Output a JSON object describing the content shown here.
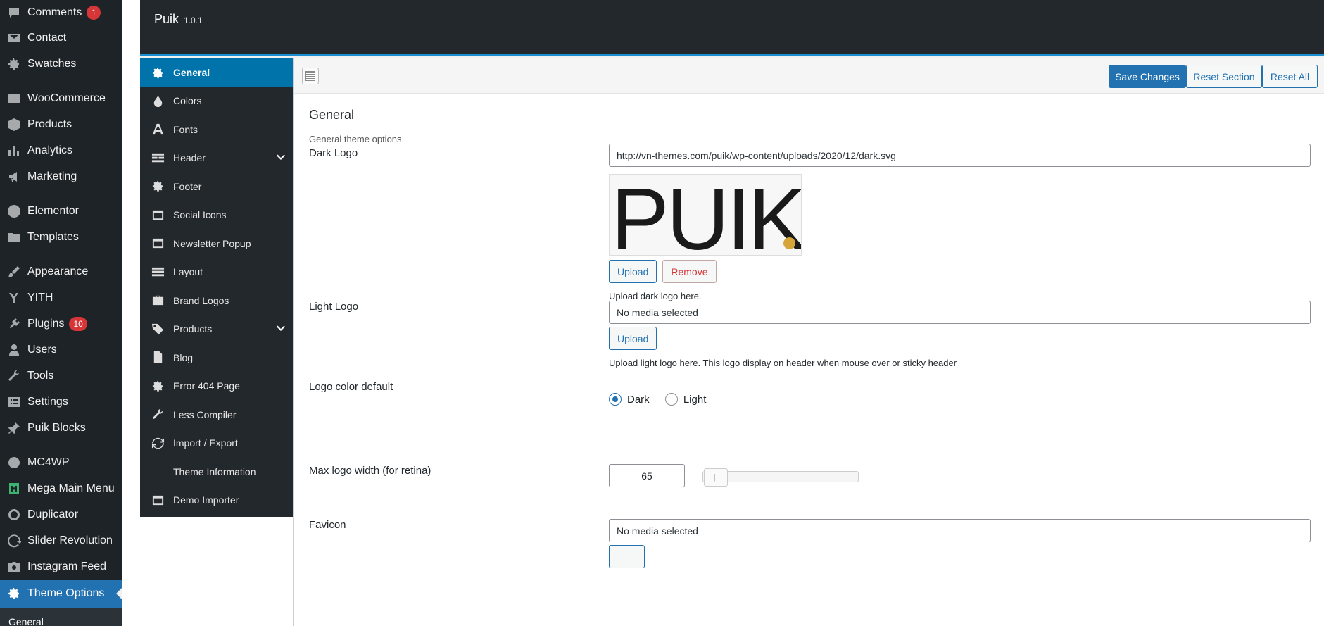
{
  "wp_sidebar": {
    "items": [
      {
        "label": "Comments",
        "icon": "comment-icon",
        "badge": "1"
      },
      {
        "label": "Contact",
        "icon": "mail-icon"
      },
      {
        "label": "Swatches",
        "icon": "gear-icon"
      },
      {
        "label": "WooCommerce",
        "icon": "woo-icon"
      },
      {
        "label": "Products",
        "icon": "box-icon"
      },
      {
        "label": "Analytics",
        "icon": "bar-chart-icon"
      },
      {
        "label": "Marketing",
        "icon": "megaphone-icon"
      },
      {
        "label": "Elementor",
        "icon": "elementor-icon"
      },
      {
        "label": "Templates",
        "icon": "folder-icon"
      },
      {
        "label": "Appearance",
        "icon": "brush-icon"
      },
      {
        "label": "YITH",
        "icon": "yith-icon"
      },
      {
        "label": "Plugins",
        "icon": "plug-icon",
        "badge": "10"
      },
      {
        "label": "Users",
        "icon": "user-icon"
      },
      {
        "label": "Tools",
        "icon": "wrench-icon"
      },
      {
        "label": "Settings",
        "icon": "settings-icon"
      },
      {
        "label": "Puik Blocks",
        "icon": "pin-icon"
      },
      {
        "label": "MC4WP",
        "icon": "mc4wp-icon"
      },
      {
        "label": "Mega Main Menu",
        "icon": "mega-menu-icon"
      },
      {
        "label": "Duplicator",
        "icon": "duplicator-icon"
      },
      {
        "label": "Slider Revolution",
        "icon": "refresh-icon"
      },
      {
        "label": "Instagram Feed",
        "icon": "camera-icon"
      },
      {
        "label": "Theme Options",
        "icon": "gear-icon"
      }
    ],
    "sub_label": "General"
  },
  "panel": {
    "title": "Puik",
    "version": "1.0.1"
  },
  "opt_menu": {
    "items": [
      {
        "label": "General",
        "icon": "gear-icon"
      },
      {
        "label": "Colors",
        "icon": "drop-icon"
      },
      {
        "label": "Fonts",
        "icon": "font-icon"
      },
      {
        "label": "Header",
        "icon": "header-icon"
      },
      {
        "label": "Footer",
        "icon": "gear-icon"
      },
      {
        "label": "Social Icons",
        "icon": "window-icon"
      },
      {
        "label": "Newsletter Popup",
        "icon": "window-icon"
      },
      {
        "label": "Layout",
        "icon": "list-icon"
      },
      {
        "label": "Brand Logos",
        "icon": "briefcase-icon"
      },
      {
        "label": "Products",
        "icon": "tags-icon"
      },
      {
        "label": "Blog",
        "icon": "document-icon"
      },
      {
        "label": "Error 404 Page",
        "icon": "gear-icon"
      },
      {
        "label": "Less Compiler",
        "icon": "wrench-icon"
      },
      {
        "label": "Import / Export",
        "icon": "refresh-icon"
      },
      {
        "label": "Theme Information",
        "icon": ""
      },
      {
        "label": "Demo Importer",
        "icon": "window-icon"
      }
    ]
  },
  "toolbar": {
    "save": "Save Changes",
    "reset_section": "Reset Section",
    "reset_all": "Reset All"
  },
  "section": {
    "title": "General",
    "description": "General theme options"
  },
  "fields": {
    "dark_logo": {
      "label": "Dark Logo",
      "value": "http://vn-themes.com/puik/wp-content/uploads/2020/12/dark.svg",
      "preview_text": "PUIK",
      "upload": "Upload",
      "remove": "Remove",
      "help": "Upload dark logo here."
    },
    "light_logo": {
      "label": "Light Logo",
      "value": "No media selected",
      "upload": "Upload",
      "help": "Upload light logo here. This logo display on header when mouse over or sticky header"
    },
    "logo_color": {
      "label": "Logo color default",
      "options": [
        "Dark",
        "Light"
      ],
      "selected": "Dark"
    },
    "max_logo_width": {
      "label": "Max logo width (for retina)",
      "value": "65"
    },
    "favicon": {
      "label": "Favicon",
      "value": "No media selected"
    }
  },
  "colors": {
    "accent": "#2271b1",
    "menu_active": "#0073aa",
    "header_bg": "#23282d",
    "logo_dot": "#d6a53a"
  }
}
